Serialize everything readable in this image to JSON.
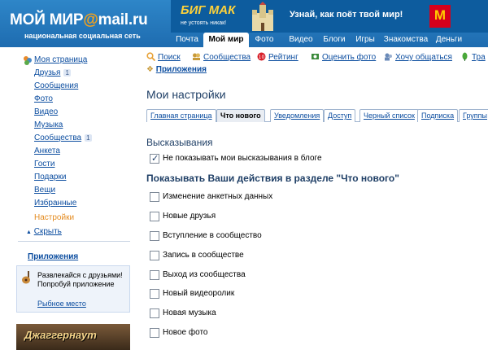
{
  "header": {
    "logo_main": "МОЙ МИР",
    "logo_at": "@",
    "logo_domain": "mail.ru",
    "slogan": "национальная социальная сеть",
    "ad": {
      "brand": "БИГ МАК",
      "brand_small": "не устоять никак!",
      "text": "Узнай, как поёт твой мир!",
      "logo": "M"
    },
    "tabs": [
      {
        "label": "Почта",
        "active": false
      },
      {
        "label": "Мой мир",
        "active": true
      },
      {
        "label": "Фото",
        "active": false
      },
      {
        "label": "Видео",
        "active": false
      },
      {
        "label": "Блоги",
        "active": false
      },
      {
        "label": "Игры",
        "active": false
      },
      {
        "label": "Знакомства",
        "active": false
      },
      {
        "label": "Деньги",
        "active": false
      }
    ]
  },
  "sidebar": {
    "items": [
      {
        "label": "Моя страница",
        "badge": ""
      },
      {
        "label": "Друзья",
        "badge": "1"
      },
      {
        "label": "Сообщения",
        "badge": ""
      },
      {
        "label": "Фото",
        "badge": ""
      },
      {
        "label": "Видео",
        "badge": ""
      },
      {
        "label": "Музыка",
        "badge": ""
      },
      {
        "label": "Сообщества",
        "badge": "1"
      },
      {
        "label": "Анкета",
        "badge": ""
      },
      {
        "label": "Гости",
        "badge": ""
      },
      {
        "label": "Подарки",
        "badge": ""
      },
      {
        "label": "Вещи",
        "badge": ""
      },
      {
        "label": "Избранные",
        "badge": ""
      },
      {
        "label": "Настройки",
        "badge": ""
      }
    ],
    "hide_label": "Скрыть",
    "apps_title": "Приложения",
    "promo": {
      "text_line1": "Развлекайся с друзьями!",
      "text_line2": "Попробуй приложение",
      "link": "Рыбное место"
    },
    "game_banner": "Джаггернаут"
  },
  "toplinks": {
    "items": [
      {
        "label": "Поиск",
        "icon": "magnifier-icon",
        "color": "#e8a33a"
      },
      {
        "label": "Сообщества",
        "icon": "people-icon",
        "color": "#c89a3a"
      },
      {
        "label": "Рейтинг",
        "icon": "rating-icon",
        "color": "#d8202a"
      },
      {
        "label": "Оценить фото",
        "icon": "rate-photo-icon",
        "color": "#3a8a3a"
      },
      {
        "label": "Хочу общаться",
        "icon": "chat-icon",
        "color": "#6a8ab8"
      },
      {
        "label": "Тра",
        "icon": "leaf-icon",
        "color": "#4aa83a"
      }
    ],
    "apps_label": "Приложения"
  },
  "main": {
    "title": "Мои настройки",
    "subtabs": [
      {
        "label": "Главная страница",
        "active": false
      },
      {
        "label": "Что нового",
        "active": true
      },
      {
        "label": "Уведомления",
        "active": false
      },
      {
        "label": "Доступ",
        "active": false
      },
      {
        "label": "Черный список",
        "active": false
      },
      {
        "label": "Подписка",
        "active": false
      },
      {
        "label": "Группы",
        "active": false
      }
    ],
    "section1_title": "Высказывания",
    "section1_options": [
      {
        "label": "Не показывать мои высказывания в блоге",
        "checked": true
      }
    ],
    "section2_title": "Показывать Ваши действия в разделе \"Что нового\"",
    "section2_options": [
      {
        "label": "Изменение анкетных данных",
        "checked": false
      },
      {
        "label": "Новые друзья",
        "checked": false
      },
      {
        "label": "Вступление в сообщество",
        "checked": false
      },
      {
        "label": "Запись в сообществе",
        "checked": false
      },
      {
        "label": "Выход из сообщества",
        "checked": false
      },
      {
        "label": "Новый видеоролик",
        "checked": false
      },
      {
        "label": "Новая музыка",
        "checked": false
      },
      {
        "label": "Новое фото",
        "checked": false
      }
    ]
  },
  "colors": {
    "header_blue": "#1e6cb0",
    "link_blue": "#0a4c9f",
    "title_blue": "#1f3f66",
    "active_orange": "#e48b1f",
    "logo_orange": "#f6a21a"
  }
}
